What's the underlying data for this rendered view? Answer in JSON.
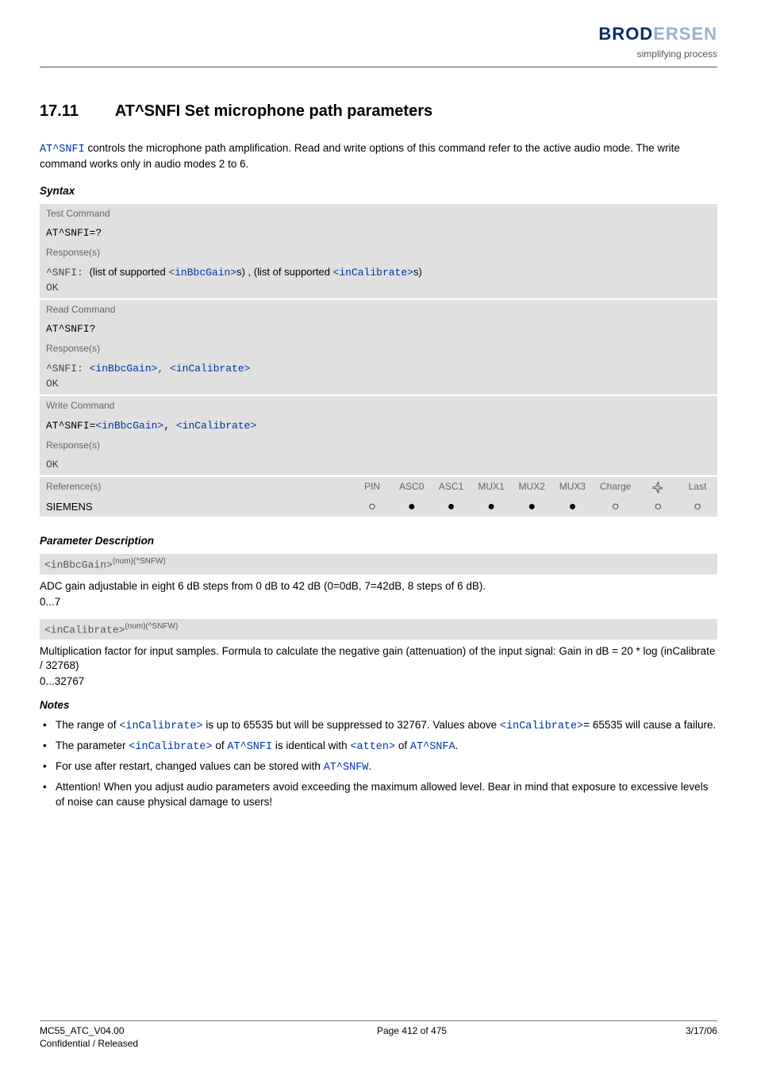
{
  "brand": {
    "name_left": "BROD",
    "name_right": "ERSEN",
    "tagline": "simplifying process"
  },
  "section": {
    "number": "17.11",
    "title": "AT^SNFI   Set microphone path parameters"
  },
  "intro": {
    "cmd": "AT^SNFI",
    "text_after": " controls the microphone path amplification. Read and write options of this command refer to the active audio mode. The write command works only in audio modes 2 to 6."
  },
  "labels": {
    "syntax": "Syntax",
    "test_command": "Test Command",
    "read_command": "Read Command",
    "write_command": "Write Command",
    "responses": "Response(s)",
    "references": "Reference(s)",
    "param_desc": "Parameter Description",
    "notes": "Notes"
  },
  "syntax": {
    "test_cmd": "AT^SNFI=?",
    "test_resp_prefix": "^SNFI: ",
    "test_resp_mid1": "(list of supported ",
    "test_resp_p1": "<inBbcGain>",
    "test_resp_mid2": "s) , (list of supported ",
    "test_resp_p2": "<inCalibrate>",
    "test_resp_suffix": "s)",
    "ok": "OK",
    "read_cmd": "AT^SNFI?",
    "read_resp_prefix": "^SNFI: ",
    "read_p1": "<inBbcGain>",
    "read_sep": ", ",
    "read_p2": "<inCalibrate>",
    "write_cmd_prefix": "AT^SNFI=",
    "write_p1": "<inBbcGain>",
    "write_sep": ", ",
    "write_p2": "<inCalibrate>"
  },
  "ref_table": {
    "cols": [
      "PIN",
      "ASC0",
      "ASC1",
      "MUX1",
      "MUX2",
      "MUX3",
      "Charge",
      "",
      "Last"
    ],
    "vendor": "SIEMENS",
    "marks": [
      "open",
      "filled",
      "filled",
      "filled",
      "filled",
      "filled",
      "open",
      "open",
      "open"
    ]
  },
  "params": [
    {
      "name": "<inBbcGain>",
      "suffix": "(num)(^SNFW)",
      "desc": "ADC gain adjustable in eight 6 dB steps from 0 dB to 42 dB (0=0dB, 7=42dB, 8 steps of 6 dB).",
      "range": "0...7"
    },
    {
      "name": "<inCalibrate>",
      "suffix": "(num)(^SNFW)",
      "desc": "Multiplication factor for input samples. Formula to calculate the negative gain (attenuation) of the input signal: Gain in dB = 20 * log (inCalibrate / 32768)",
      "range": "0...32767"
    }
  ],
  "notes": [
    {
      "pre": "The range of ",
      "p1": "<inCalibrate>",
      "mid": " is up to 65535 but will be suppressed to 32767. Values above ",
      "p2": "<inCalibrate>",
      "post": "= 65535 will cause a failure."
    },
    {
      "pre": "The parameter ",
      "p1": "<inCalibrate>",
      "mid": " of ",
      "c1": "AT^SNFI",
      "mid2": " is identical with ",
      "p2": "<atten>",
      "mid3": " of ",
      "c2": "AT^SNFA",
      "post": "."
    },
    {
      "pre": "For use after restart, changed values can be stored with ",
      "c1": "AT^SNFW",
      "post": "."
    },
    {
      "pre": "Attention! When you adjust audio parameters avoid exceeding the maximum allowed level. Bear in mind that exposure to excessive levels of noise can cause physical damage to users!"
    }
  ],
  "footer": {
    "left1": "MC55_ATC_V04.00",
    "left2": "Confidential / Released",
    "center": "Page 412 of 475",
    "right": "3/17/06"
  }
}
